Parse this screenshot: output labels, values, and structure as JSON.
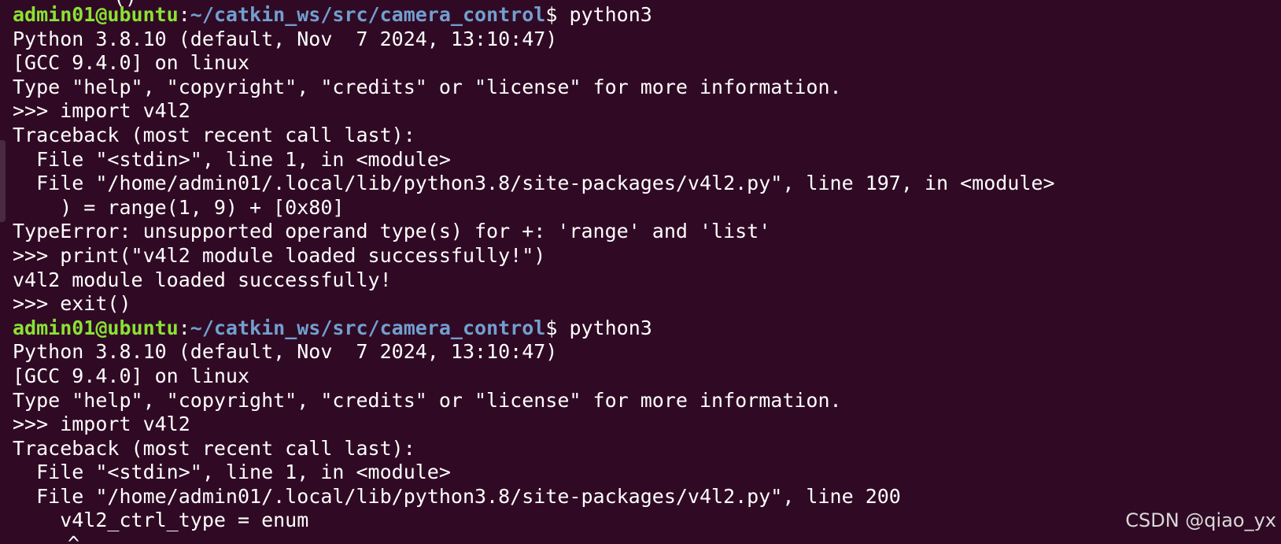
{
  "terminal": {
    "clipped_top_text": "()",
    "clipped_bottom_text": "^",
    "prompt": {
      "user_host": "admin01@ubuntu",
      "separator": ":",
      "path": "~/catkin_ws/src/camera_control",
      "symbol": "$ "
    },
    "lines": [
      {
        "type": "prompt",
        "command": "python3"
      },
      {
        "type": "output",
        "text": "Python 3.8.10 (default, Nov  7 2024, 13:10:47)"
      },
      {
        "type": "output",
        "text": "[GCC 9.4.0] on linux"
      },
      {
        "type": "output",
        "text": "Type \"help\", \"copyright\", \"credits\" or \"license\" for more information."
      },
      {
        "type": "output",
        "text": ">>> import v4l2"
      },
      {
        "type": "output",
        "text": "Traceback (most recent call last):"
      },
      {
        "type": "output",
        "text": "  File \"<stdin>\", line 1, in <module>"
      },
      {
        "type": "output",
        "text": "  File \"/home/admin01/.local/lib/python3.8/site-packages/v4l2.py\", line 197, in <module>"
      },
      {
        "type": "output",
        "text": "    ) = range(1, 9) + [0x80]"
      },
      {
        "type": "output",
        "text": "TypeError: unsupported operand type(s) for +: 'range' and 'list'"
      },
      {
        "type": "output",
        "text": ">>> print(\"v4l2 module loaded successfully!\")"
      },
      {
        "type": "output",
        "text": "v4l2 module loaded successfully!"
      },
      {
        "type": "output",
        "text": ">>> exit()"
      },
      {
        "type": "prompt",
        "command": "python3"
      },
      {
        "type": "output",
        "text": "Python 3.8.10 (default, Nov  7 2024, 13:10:47)"
      },
      {
        "type": "output",
        "text": "[GCC 9.4.0] on linux"
      },
      {
        "type": "output",
        "text": "Type \"help\", \"copyright\", \"credits\" or \"license\" for more information."
      },
      {
        "type": "output",
        "text": ">>> import v4l2"
      },
      {
        "type": "output",
        "text": "Traceback (most recent call last):"
      },
      {
        "type": "output",
        "text": "  File \"<stdin>\", line 1, in <module>"
      },
      {
        "type": "output",
        "text": "  File \"/home/admin01/.local/lib/python3.8/site-packages/v4l2.py\", line 200"
      },
      {
        "type": "output",
        "text": "    v4l2_ctrl_type = enum"
      }
    ]
  },
  "watermark": "CSDN @qiao_yx",
  "colors": {
    "background": "#300a24",
    "text": "#ffffff",
    "prompt_user": "#8ae234",
    "prompt_path": "#729fcf"
  }
}
